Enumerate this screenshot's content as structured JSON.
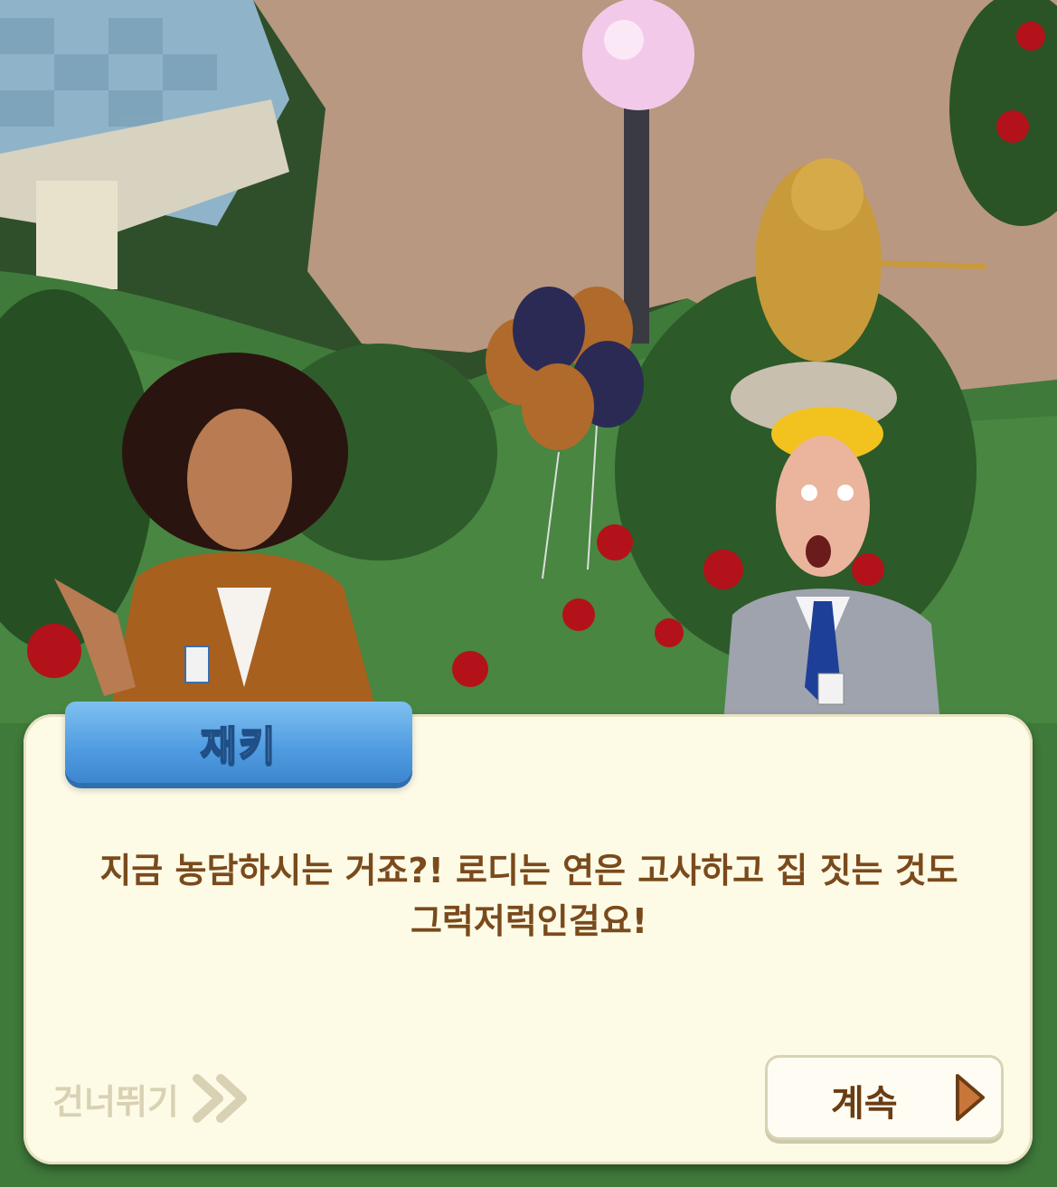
{
  "dialog": {
    "speaker": "재키",
    "lines": [
      "지금 농담하시는 거죠?! 로디는 연은 고사하고 집 짓는 것도",
      "그럭저럭인걸요!"
    ]
  },
  "controls": {
    "skip_label": "건너뛰기",
    "continue_label": "계속"
  },
  "colors": {
    "name_tab": "#4f9be0",
    "dialog_bg": "#fdfbe6",
    "text": "#7a4a1c",
    "skip": "#d9d1b3",
    "continue_arrow": "#c9763a"
  },
  "icons": {
    "skip": "double-chevron-right",
    "continue": "play-triangle-right"
  }
}
